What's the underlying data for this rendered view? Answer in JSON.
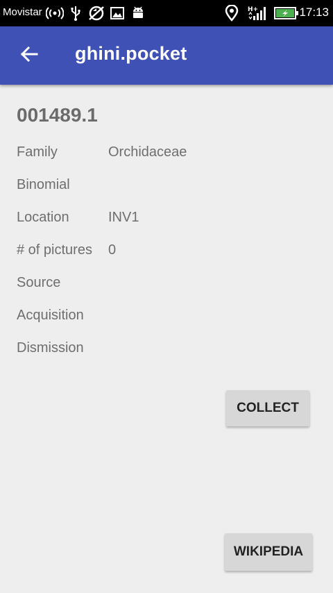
{
  "status_bar": {
    "carrier": "Movistar",
    "time": "17:13",
    "icons": [
      "hotspot-icon",
      "usb-icon",
      "no-sync-icon",
      "image-icon",
      "android-debug-icon",
      "location-pin-icon",
      "signal-h-plus-icon",
      "battery-charging-icon"
    ]
  },
  "app_bar": {
    "title": "ghini.pocket",
    "color": "#3f51b5"
  },
  "plant": {
    "code": "001489.1",
    "rows": [
      {
        "label": "Family",
        "value": "Orchidaceae"
      },
      {
        "label": "Binomial",
        "value": ""
      },
      {
        "label": "Location",
        "value": "INV1"
      },
      {
        "label": "# of pictures",
        "value": "0"
      },
      {
        "label": "Source",
        "value": ""
      },
      {
        "label": "Acquisition",
        "value": ""
      },
      {
        "label": "Dismission",
        "value": ""
      }
    ]
  },
  "buttons": {
    "collect": "COLLECT",
    "wikipedia": "WIKIPEDIA"
  }
}
